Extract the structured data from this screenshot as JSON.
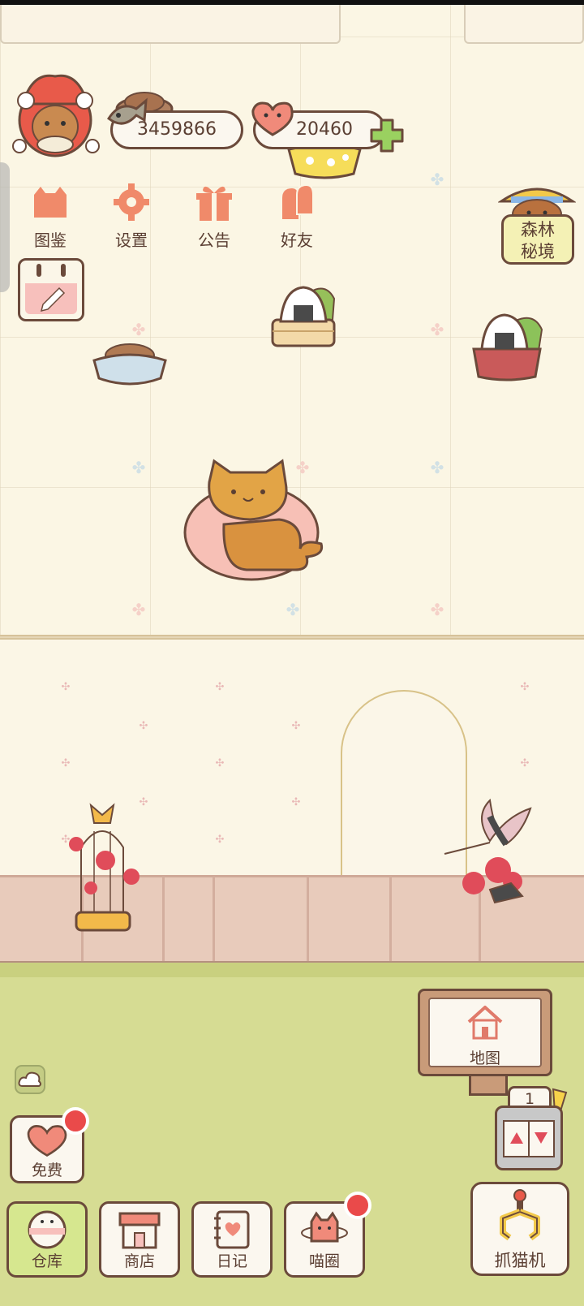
{
  "hud": {
    "coins": "3459866",
    "hearts": "20460"
  },
  "menu": {
    "items": [
      {
        "label": "图鉴",
        "icon": "cat-book-icon"
      },
      {
        "label": "设置",
        "icon": "gear-icon"
      },
      {
        "label": "公告",
        "icon": "gift-icon"
      },
      {
        "label": "好友",
        "icon": "friends-icon"
      }
    ]
  },
  "forest": {
    "label_line1": "森林",
    "label_line2": "秘境"
  },
  "map": {
    "label": "地图"
  },
  "machine": {
    "count": "1"
  },
  "bottom": {
    "free_label": "免费",
    "warehouse_label": "仓库",
    "shop_label": "商店",
    "diary_label": "日记",
    "circle_label": "喵圈",
    "claw_label": "抓猫机"
  },
  "colors": {
    "wall": "#fbf6e4",
    "grass": "#d6dc93",
    "floor": "#e8cbbb",
    "outline": "#6b4a3b",
    "accent_red": "#ea4a4a",
    "icon_orange": "#f08a6a"
  }
}
